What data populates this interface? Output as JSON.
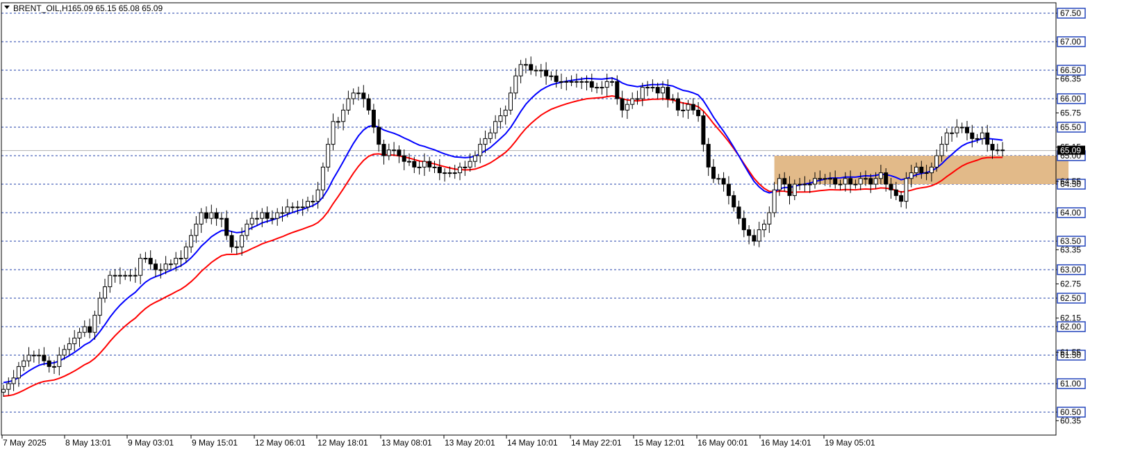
{
  "header": {
    "symbol": "BRENT_OIL,H1",
    "ohlc": "65.09 65.15 65.08 65.09"
  },
  "colors": {
    "ema_fast": "#0000ff",
    "ema_slow": "#ff0000",
    "zone_fill": "#dfb27c",
    "grid": "#1f3fa8",
    "bull_candle": "#ffffff",
    "bear_candle": "#000000",
    "label_box": "#2244bb"
  },
  "chart_data": {
    "type": "line",
    "subtype": "candlestick",
    "title": "",
    "ylim": [
      60.2,
      67.65
    ],
    "grid": "horizontal dashed",
    "y_level_labels": [
      "67.50",
      "67.00",
      "66.50",
      "66.00",
      "65.50",
      "65.00",
      "64.50",
      "64.00",
      "63.50",
      "63.00",
      "62.50",
      "62.00",
      "61.50",
      "61.00",
      "60.50"
    ],
    "y_plain_ticks": [
      "66.35",
      "65.75",
      "65.15",
      "64.55",
      "63.35",
      "62.75",
      "62.15",
      "61.55",
      "60.35"
    ],
    "current_price": "65.09",
    "x_ticks": [
      "7 May 2025",
      "8 May 13:01",
      "9 May 03:01",
      "9 May 15:01",
      "12 May 06:01",
      "12 May 18:01",
      "13 May 08:01",
      "13 May 20:01",
      "14 May 10:01",
      "14 May 22:01",
      "15 May 12:01",
      "16 May 00:01",
      "16 May 14:01",
      "19 May 05:01"
    ],
    "zone": {
      "y_top": 65.0,
      "y_bottom": 64.5,
      "x_start_bar": 152,
      "x_end_bar": 210
    },
    "closes": [
      60.9,
      61.0,
      61.1,
      61.3,
      61.4,
      61.5,
      61.5,
      61.5,
      61.4,
      61.3,
      61.3,
      61.5,
      61.6,
      61.7,
      61.8,
      61.9,
      62.0,
      61.9,
      62.2,
      62.5,
      62.7,
      62.9,
      62.9,
      62.9,
      62.9,
      62.9,
      62.9,
      63.2,
      63.2,
      63.1,
      63.0,
      63.0,
      63.1,
      63.1,
      63.2,
      63.2,
      63.4,
      63.6,
      63.8,
      64.0,
      63.9,
      64.0,
      63.9,
      63.9,
      63.6,
      63.4,
      63.4,
      63.6,
      63.8,
      63.9,
      63.9,
      64.0,
      63.9,
      63.9,
      64.0,
      64.0,
      64.1,
      64.1,
      64.1,
      64.1,
      64.2,
      64.2,
      64.4,
      64.8,
      65.2,
      65.6,
      65.6,
      65.8,
      66.0,
      66.1,
      66.1,
      66.0,
      65.8,
      65.5,
      65.2,
      65.0,
      65.1,
      65.1,
      65.0,
      64.9,
      64.9,
      64.8,
      64.8,
      64.9,
      64.8,
      64.8,
      64.7,
      64.7,
      64.7,
      64.7,
      64.8,
      64.8,
      64.9,
      65.0,
      65.2,
      65.3,
      65.4,
      65.6,
      65.7,
      65.8,
      66.1,
      66.4,
      66.6,
      66.6,
      66.5,
      66.5,
      66.5,
      66.4,
      66.4,
      66.3,
      66.3,
      66.3,
      66.3,
      66.3,
      66.3,
      66.3,
      66.2,
      66.2,
      66.2,
      66.3,
      66.3,
      66.0,
      65.8,
      65.9,
      66.0,
      66.0,
      66.2,
      66.2,
      66.2,
      66.1,
      66.2,
      66.0,
      66.0,
      65.8,
      65.8,
      65.9,
      65.8,
      65.7,
      65.2,
      64.8,
      64.6,
      64.6,
      64.5,
      64.3,
      64.1,
      63.9,
      63.7,
      63.6,
      63.5,
      63.7,
      63.8,
      64.0,
      64.4,
      64.6,
      64.5,
      64.3,
      64.5,
      64.5,
      64.5,
      64.5,
      64.6,
      64.6,
      64.6,
      64.6,
      64.5,
      64.5,
      64.6,
      64.5,
      64.5,
      64.6,
      64.6,
      64.5,
      64.6,
      64.7,
      64.5,
      64.4,
      64.3,
      64.2,
      64.6,
      64.7,
      64.8,
      64.7,
      64.7,
      64.8,
      65.0,
      65.2,
      65.4,
      65.4,
      65.5,
      65.5,
      65.4,
      65.3,
      65.3,
      65.4,
      65.2,
      65.1,
      65.1,
      65.09
    ]
  }
}
